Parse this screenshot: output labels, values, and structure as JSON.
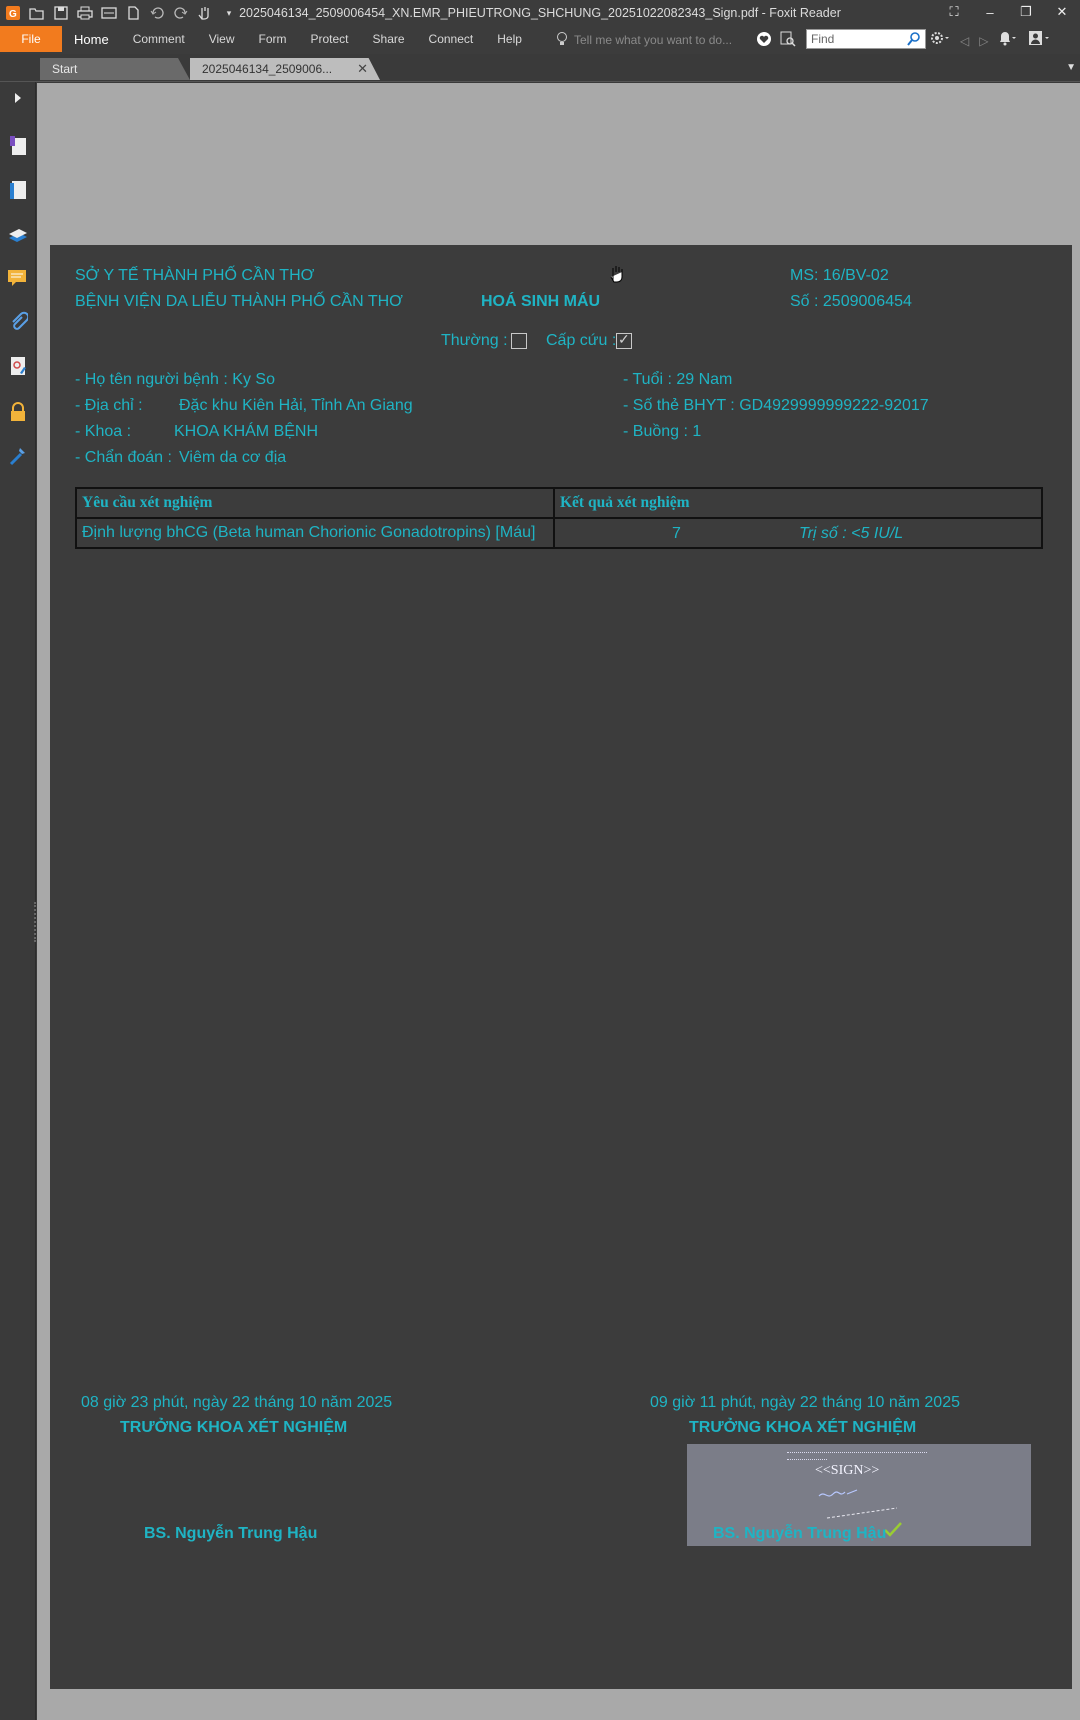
{
  "window": {
    "title": "2025046134_2509006454_XN.EMR_PHIEUTRONG_SHCHUNG_20251022082343_Sign.pdf - Foxit Reader"
  },
  "menu": {
    "file": "File",
    "items": [
      "Home",
      "Comment",
      "View",
      "Form",
      "Protect",
      "Share",
      "Connect",
      "Help"
    ],
    "tellme_placeholder": "Tell me what you want to do...",
    "find_placeholder": "Find"
  },
  "tabs": {
    "start": "Start",
    "doc": "2025046134_2509006..."
  },
  "document": {
    "dept_line1": "SỞ Y TẾ THÀNH PHỐ CẦN THƠ",
    "dept_line2": "BỆNH VIỆN DA LIỄU THÀNH PHỐ CẦN THƠ",
    "form_title": "HOÁ SINH MÁU",
    "ms": "MS: 16/BV-02",
    "so": "Số : 2509006454",
    "normal_label": "Thường :",
    "emergency_label": "Cấp cứu :",
    "normal_checked": false,
    "emergency_checked": true,
    "patient_name": "- Họ tên người bệnh : Ky So",
    "address_label": "- Địa chỉ :",
    "address": "Đặc khu Kiên Hải, Tỉnh An Giang",
    "dept_label": "- Khoa :",
    "dept": "KHOA KHÁM BỆNH",
    "diagnosis_label": "- Chẩn đoán :",
    "diagnosis": "Viêm da cơ địa",
    "age": "- Tuổi : 29 Nam",
    "insurance": "- Số thẻ BHYT : GD4929999999222-92017",
    "room": "- Buồng : 1",
    "table": {
      "headers": [
        "Yêu cầu xét nghiệm",
        "Kết quả xét nghiệm"
      ],
      "rows": [
        {
          "test": "Định lượng bhCG (Beta human Chorionic Gonadotropins) [Máu]",
          "result": "7",
          "reference": "Trị số : <5 IU/L"
        }
      ]
    },
    "left_time": "08 giờ 23 phút, ngày 22 tháng 10 năm 2025",
    "left_title": "TRƯỞNG KHOA XÉT NGHIỆM",
    "left_name": "BS. Nguyễn Trung Hậu",
    "right_time": "09 giờ 11 phút, ngày 22 tháng 10 năm 2025",
    "right_title": "TRƯỞNG KHOA XÉT NGHIỆM",
    "right_name": "BS. Nguyễn Trung Hậu",
    "signature_text": "<<SIGN>>"
  },
  "colors": {
    "accent_orange": "#f27b1e",
    "doc_text": "#1fb4c4",
    "page_bg": "#3c3c3c",
    "canvas_bg": "#a9a9a9"
  }
}
